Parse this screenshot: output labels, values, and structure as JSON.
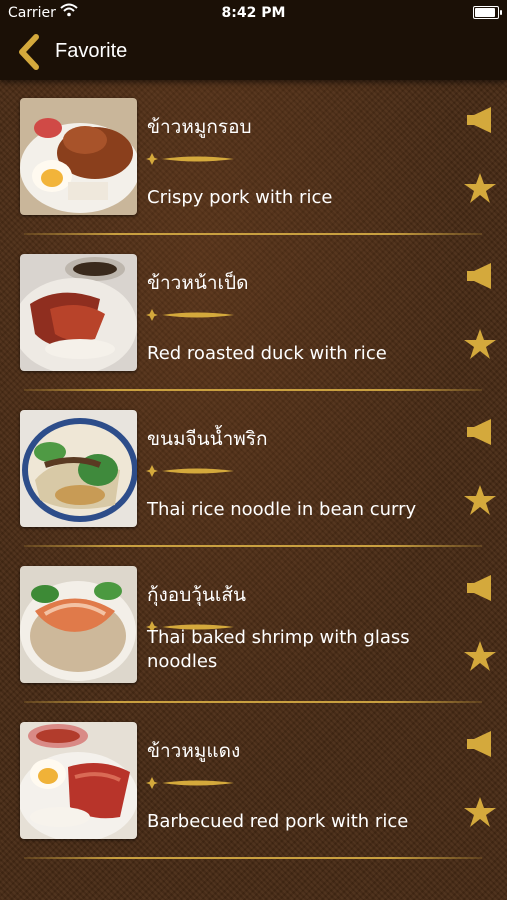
{
  "status": {
    "carrier": "Carrier",
    "time": "8:42 PM"
  },
  "nav": {
    "title": "Favorite"
  },
  "colors": {
    "accent": "#d4a93c",
    "header_bg": "#1b1006",
    "background": "#4a2c16"
  },
  "items": [
    {
      "thai": "ข้าวหมูกรอบ",
      "english": "Crispy pork with rice"
    },
    {
      "thai": "ข้าวหน้าเป็ด",
      "english": "Red roasted duck with rice"
    },
    {
      "thai": "ขนมจีนน้ำพริก",
      "english": "Thai rice noodle in bean curry"
    },
    {
      "thai": "กุ้งอบวุ้นเส้น",
      "english": "Thai baked shrimp with glass noodles"
    },
    {
      "thai": "ข้าวหมูแดง",
      "english": "Barbecued red pork with rice"
    }
  ]
}
